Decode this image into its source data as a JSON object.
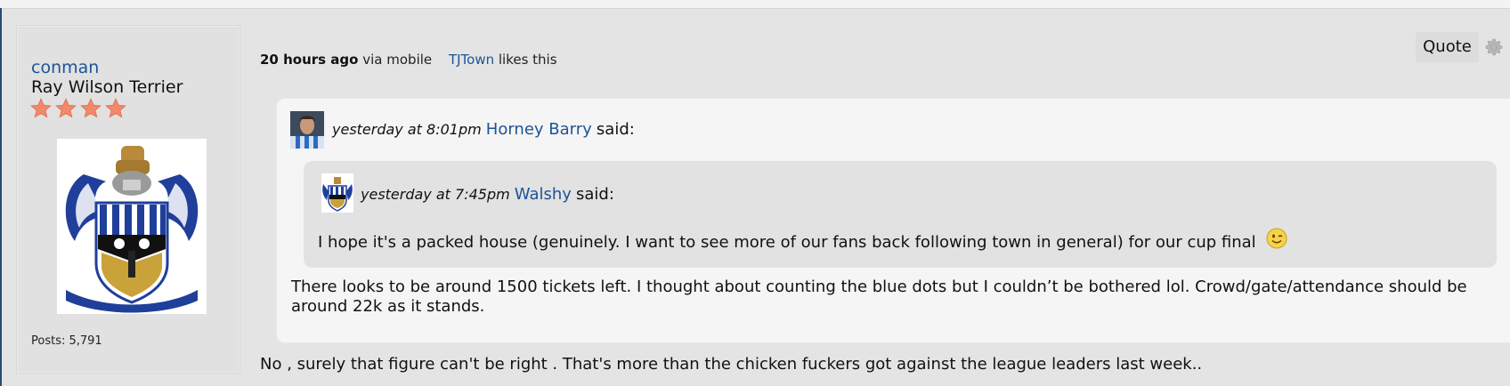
{
  "author": {
    "username": "conman",
    "rank": "Ray Wilson Terrier",
    "star_count": 4,
    "posts": "Posts: 5,791"
  },
  "post_meta": {
    "time": "20 hours ago",
    "via": "via mobile",
    "liker": "TJTown",
    "likes_text": "likes this"
  },
  "actions": {
    "quote_label": "Quote"
  },
  "quote_outer": {
    "time": "yesterday at 8:01pm",
    "author": "Horney Barry",
    "said": "said:",
    "line1": "There looks to be around 1500 tickets left. I thought about counting the blue dots but I couldn’t be bothered lol. Crowd/gate/attendance should be",
    "line2": "around 22k as it stands."
  },
  "quote_inner": {
    "time": "yesterday at 7:45pm",
    "author": "Walshy",
    "said": "said:",
    "text": "I hope it's a packed house (genuinely. I want to see more of our fans back following town in general) for our cup final"
  },
  "reply_text": "No , surely that figure can't be right . That's more than the chicken fuckers got against the league leaders last week..",
  "colors": {
    "link": "#1d5396",
    "star": "#f08a6a",
    "accent_blue": "#2a4a7a"
  }
}
